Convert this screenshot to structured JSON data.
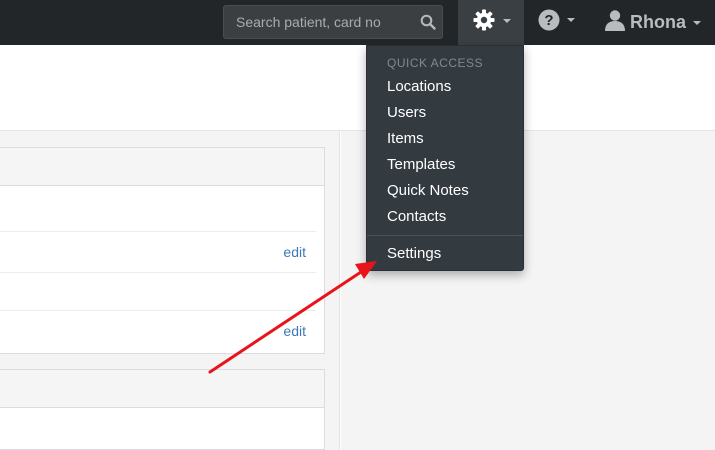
{
  "navbar": {
    "search_placeholder": "Search patient, card no",
    "search_icon": "search-icon",
    "gear_icon": "gear-icon",
    "help_icon": "question-circle-icon",
    "user_icon": "user-icon",
    "user_name": "Rhona"
  },
  "dropdown": {
    "header": "QUICK ACCESS",
    "items": [
      {
        "label": "Locations"
      },
      {
        "label": "Users"
      },
      {
        "label": "Items"
      },
      {
        "label": "Templates"
      },
      {
        "label": "Quick Notes"
      },
      {
        "label": "Contacts"
      }
    ],
    "settings_label": "Settings"
  },
  "panel": {
    "edit_label": "edit"
  },
  "colors": {
    "navbar_bg": "#222629",
    "dropdown_bg": "#333a40",
    "link": "#3f78b5",
    "arrow": "#e8141c"
  }
}
